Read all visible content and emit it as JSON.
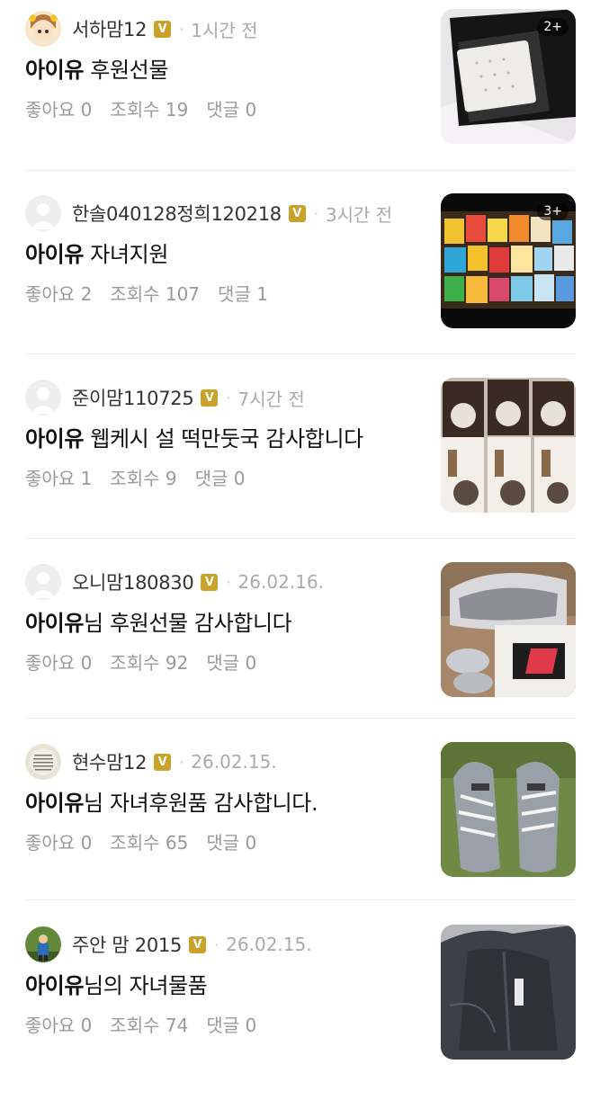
{
  "posts": [
    {
      "nickname": "서하맘12",
      "badge": "V",
      "time": "1시간 전",
      "title_keyword": "아이유",
      "title_rest": " 후원선물",
      "likes_label": "좋아요",
      "likes": "0",
      "views_label": "조회수",
      "views": "19",
      "comments_label": "댓글",
      "comments": "0",
      "image_count": "2+",
      "thumb_icon": "clothes-photo"
    },
    {
      "nickname": "한솔040128정희120218",
      "badge": "V",
      "time": "3시간 전",
      "title_keyword": "아이유",
      "title_rest": " 자녀지원",
      "likes_label": "좋아요",
      "likes": "2",
      "views_label": "조회수",
      "views": "107",
      "comments_label": "댓글",
      "comments": "1",
      "image_count": "3+",
      "thumb_icon": "snacks-photo"
    },
    {
      "nickname": "준이맘110725",
      "badge": "V",
      "time": "7시간 전",
      "title_keyword": "아이유",
      "title_rest": " 웹케시 설 떡만둣국 감사합니다",
      "likes_label": "좋아요",
      "likes": "1",
      "views_label": "조회수",
      "views": "9",
      "comments_label": "댓글",
      "comments": "0",
      "image_count": "",
      "thumb_icon": "food-packages-photo"
    },
    {
      "nickname": "오니맘180830",
      "badge": "V",
      "time": "26.02.16.",
      "title_keyword": "아이유",
      "title_rest": "님 후원선물 감사합니다",
      "likes_label": "좋아요",
      "likes": "0",
      "views_label": "조회수",
      "views": "92",
      "comments_label": "댓글",
      "comments": "0",
      "image_count": "",
      "thumb_icon": "shoes-box-photo"
    },
    {
      "nickname": "현수맘12",
      "badge": "V",
      "time": "26.02.15.",
      "title_keyword": "아이유",
      "title_rest": "님 자녀후원품 감사합니다.",
      "likes_label": "좋아요",
      "likes": "0",
      "views_label": "조회수",
      "views": "65",
      "comments_label": "댓글",
      "comments": "0",
      "image_count": "",
      "thumb_icon": "sneakers-photo"
    },
    {
      "nickname": "주안 맘 2015",
      "badge": "V",
      "time": "26.02.15.",
      "title_keyword": "아이유",
      "title_rest": "님의 자녀물품",
      "likes_label": "좋아요",
      "likes": "0",
      "views_label": "조회수",
      "views": "74",
      "comments_label": "댓글",
      "comments": "0",
      "image_count": "",
      "thumb_icon": "jacket-photo"
    }
  ],
  "colors": {
    "badge": "#c9a227",
    "muted": "#9a9a9a",
    "divider": "#ececec"
  }
}
